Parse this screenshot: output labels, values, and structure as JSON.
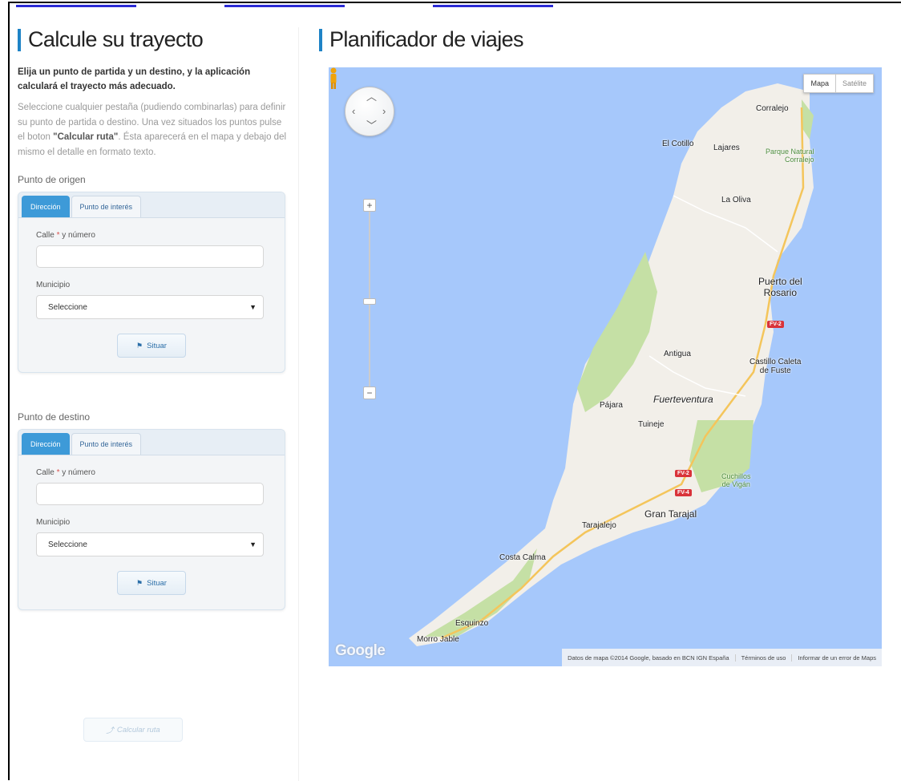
{
  "left": {
    "title": "Calcule su trayecto",
    "intro_bold": "Elija un punto de partida y un destino, y la aplicación calculará el trayecto más adecuado.",
    "intro_text_1": "Seleccione cualquier pestaña (pudiendo combinarlas) para definir su punto de partida o destino. Una vez situados los puntos pulse el boton ",
    "intro_text_strong": "\"Calcular ruta\"",
    "intro_text_2": ". Ésta aparecerá en el mapa y debajo del mismo el detalle en formato texto.",
    "origin": {
      "section_label": "Punto de origen",
      "tabs": [
        "Dirección",
        "Punto de interés"
      ],
      "street_label": "Calle",
      "street_label_suffix": " y número",
      "street_value": "",
      "municipality_label": "Municipio",
      "municipality_value": "Seleccione",
      "locate_button": "Situar"
    },
    "destination": {
      "section_label": "Punto de destino",
      "tabs": [
        "Dirección",
        "Punto de interés"
      ],
      "street_label": "Calle",
      "street_label_suffix": " y número",
      "street_value": "",
      "municipality_label": "Municipio",
      "municipality_value": "Seleccione",
      "locate_button": "Situar"
    },
    "calculate_button": "Calcular ruta"
  },
  "right": {
    "title": "Planificador de viajes",
    "map": {
      "type_options": [
        "Mapa",
        "Satélite"
      ],
      "selected_type": "Mapa",
      "places": {
        "corralejo": "Corralejo",
        "el_cotillo": "El Cotillo",
        "lajares": "Lajares",
        "parque_natural": "Parque Natural\nCorralejo",
        "la_oliva": "La Oliva",
        "puerto_del_rosario": "Puerto del\nRosario",
        "antigua": "Antigua",
        "castillo_caleta": "Castillo Caleta\nde Fuste",
        "pajara": "Pájara",
        "fuerteventura": "Fuerteventura",
        "tuineje": "Tuineje",
        "cuchillos": "Cuchillos\nde Vigán",
        "gran_tarajal": "Gran Tarajal",
        "tarajalejo": "Tarajalejo",
        "costa_calma": "Costa Calma",
        "esquinzo": "Esquinzo",
        "morro_jable": "Morro Jable"
      },
      "roads": [
        "FV-2",
        "FV-2",
        "FV-4"
      ],
      "logo": "Google",
      "attribution": [
        "Datos de mapa ©2014 Google, basado en BCN IGN España",
        "Términos de uso",
        "Informar de un error de Maps"
      ],
      "colors": {
        "sea": "#a6c8fb",
        "land": "#f2efe9",
        "park": "#c5e0a5",
        "road": "#f4c55b"
      }
    }
  }
}
